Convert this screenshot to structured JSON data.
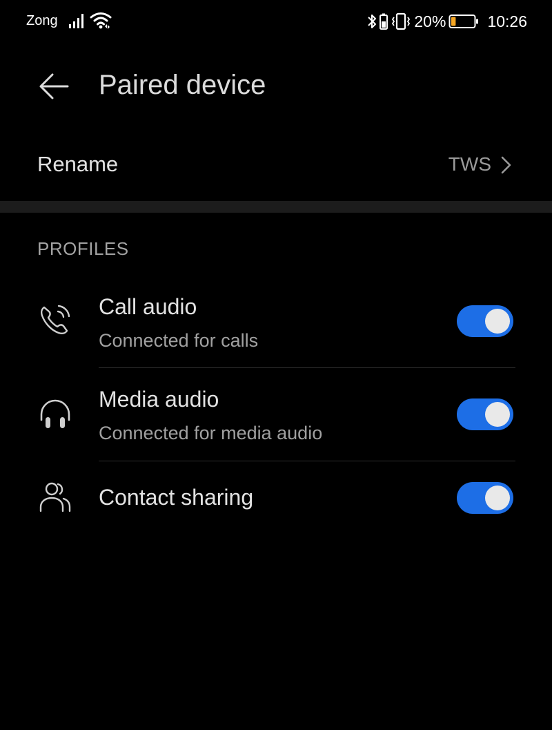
{
  "status_bar": {
    "carrier": "Zong",
    "battery_percent": "20%",
    "time": "10:26",
    "icons": [
      "signal-icon",
      "wifi-icon",
      "bluetooth-icon",
      "vibrate-icon",
      "battery-icon"
    ],
    "battery_level": 0.2,
    "battery_color": "#f5a623"
  },
  "header": {
    "title": "Paired device",
    "back_icon": "arrow-left-icon"
  },
  "rename": {
    "label": "Rename",
    "value": "TWS"
  },
  "profiles": {
    "header": "PROFILES",
    "items": [
      {
        "title": "Call audio",
        "subtitle": "Connected for calls",
        "icon": "phone-call-icon",
        "enabled": true
      },
      {
        "title": "Media audio",
        "subtitle": "Connected for media audio",
        "icon": "headphones-icon",
        "enabled": true
      },
      {
        "title": "Contact sharing",
        "subtitle": "",
        "icon": "contacts-icon",
        "enabled": true
      }
    ]
  },
  "colors": {
    "background": "#000000",
    "accent": "#1d6ee6",
    "toggle_knob": "#e9e9e9",
    "divider": "#1c1c1c"
  }
}
